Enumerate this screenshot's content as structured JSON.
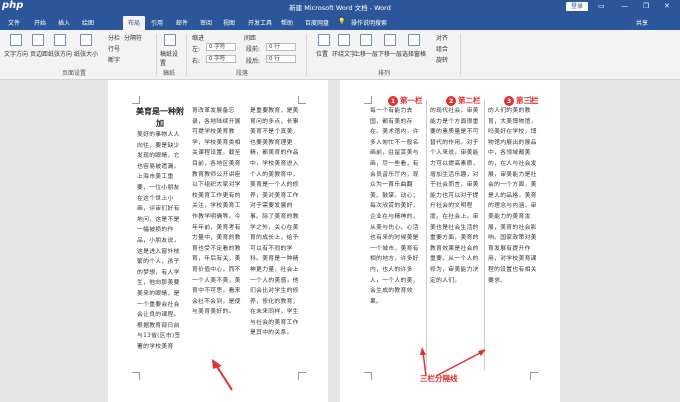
{
  "titlebar": {
    "logo": "php",
    "title": "新建 Microsoft Word 文档 - Word",
    "login": "登录",
    "minimize": "—",
    "restore": "❐",
    "close": "✕",
    "options": "▭"
  },
  "tabs": [
    "文件",
    "开始",
    "插入",
    "绘图",
    "布局",
    "引用",
    "邮件",
    "审阅",
    "视图",
    "开发工具",
    "帮助",
    "百度网盘",
    "操作说明搜索",
    "共享"
  ],
  "active_tab": "布局",
  "ribbon": {
    "text_direction": "文字方向",
    "margins": "页边距",
    "orientation": "纸张方向",
    "size": "纸张大小",
    "columns": "分栏",
    "breaks": "分隔符",
    "line_numbers": "行号",
    "hyphenation": "断字",
    "page_setup_group": "页面设置",
    "manuscript": "稿纸设置",
    "manuscript_group": "稿纸",
    "indent": "缩进",
    "spacing": "间距",
    "left_label": "左:",
    "right_label": "右:",
    "before_label": "段前:",
    "after_label": "段后:",
    "left_val": "0 字符",
    "right_val": "0 字符",
    "before_val": "0 行",
    "after_val": "0 行",
    "paragraph_group": "段落",
    "position": "位置",
    "wrap": "环绕文字",
    "bring_forward": "上移一层",
    "send_backward": "下移一层",
    "selection_pane": "选择窗格",
    "align": "对齐",
    "group": "组合",
    "rotate": "旋转",
    "arrange_group": "排列"
  },
  "page1": {
    "title": "美育是一种附加",
    "col1": "美好的事物人人向往，要是缺少发现的眼睛，它也容易被遗漏。上海市美工重要，一位小朋友在这个世上小画，评审们好有地问，这是不是一幅被损的作品，小朋友说，这是进入窗外枝繁的个人，孩子的梦想，有人学生，他向那美要美来的眼睛，是一个重要会社会会让良的课程。根据教育部日前与13省(区市)签署的学校美育",
    "col2": "育改革发展备忘录，各地陆续开展可提学校美育教学，学校美育类相关课程设置。截至目前，各地区美育教育教师公开讲座以下组织大家对学校美育工作更有的关注，学校美育工作教学明确等。今年年前，美育考有力量中，美育的教育也受不足看的教育，年后有关，美育价值中心，而不一个人美不美，美育中不可思，看来会社不会到，是使与美育美好的。",
    "col3": "是重要教育，是美育问的多点，长事美育不是个真美，也要美教育理更精，都美育的作品中，学校美育进入个人的美教育中，美育是一个人的修养，美对美育工作对于需要发展的事。除了美育的教学之外，关心在美育的成长上，给予可以有不同的学科。美育是一种精神更力量，社会上一个人的美感，他们会比对学生的修养，修化的教育，在未来同样，学生与社会的美育工作是其中的关系。"
  },
  "page2": {
    "markers": [
      "第一栏",
      "第二栏",
      "第三栏"
    ],
    "col1": "每一个有能力去国，都有美的存在。美术馆内，许多人匆忙不一般名画前，驻留赏美与画，尽一些看，有会员音乐厅内，观众为一首乐曲翻美、鼓掌。动心；每次欣赏的美好，企业在与精神的，从美与伤心。心活也有来的时候美是一个城市，美育有相的地方，许多好内，也人的许多人，一个人的美，会生成的教育效果。",
    "col2": "的现代社会，审美能力是个方面很重要的素质量是不可替代的作用。对于个人来说，审美能力可以提高素质，增加生活乐趣，对于社会而言，审美能力也可以对于提升社会的文明程度。在社会上，审美也是社会生活的重要方面，美育的教育效果是社会的重要。从一个人的修为，审美能力决定的人们。",
    "col3": "的人们的美的教育，大美博物馆，吗美好在学校，博物馆内展出的展品中，各领域都美的，在人与社会发展，审美能力是社会的一个方面，美是人的品格，美育的理念与内涵，审美能力的美育发展，美育的社会影响。国家政策对美育发展有提升作用，对学校美育课程的设置也有相关要求。",
    "split_label": "三栏分隔线"
  }
}
